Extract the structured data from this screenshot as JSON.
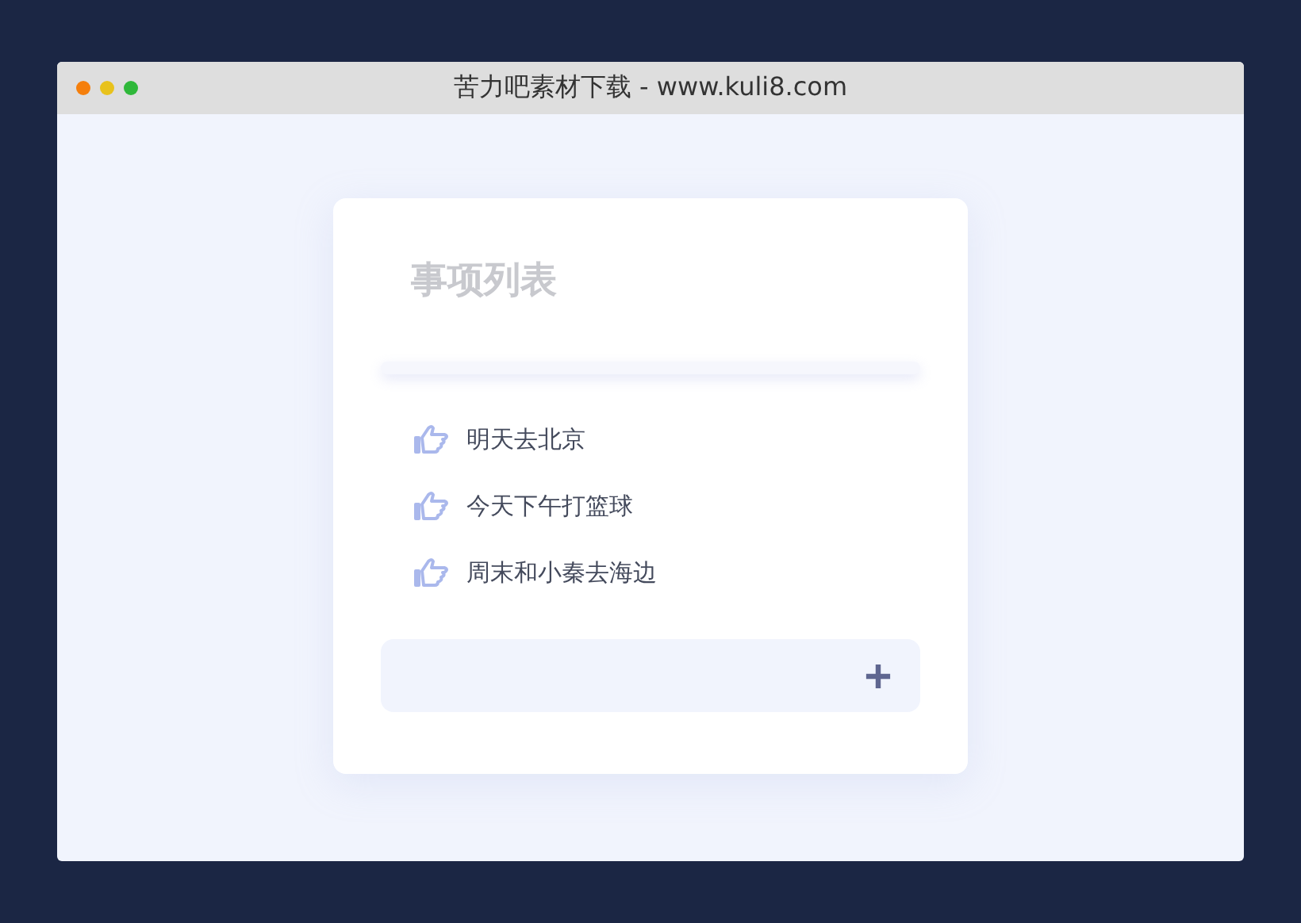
{
  "window": {
    "title": "苦力吧素材下载 - www.kuli8.com"
  },
  "card": {
    "title": "事项列表",
    "items": [
      {
        "text": "明天去北京"
      },
      {
        "text": "今天下午打篮球"
      },
      {
        "text": "周末和小秦去海边"
      }
    ]
  }
}
